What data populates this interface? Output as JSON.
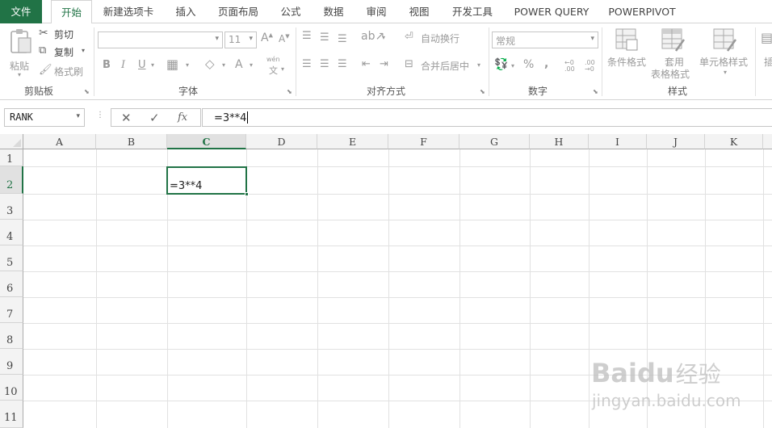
{
  "tabs": [
    {
      "label": "文件"
    },
    {
      "label": "开始"
    },
    {
      "label": "新建选项卡"
    },
    {
      "label": "插入"
    },
    {
      "label": "页面布局"
    },
    {
      "label": "公式"
    },
    {
      "label": "数据"
    },
    {
      "label": "审阅"
    },
    {
      "label": "视图"
    },
    {
      "label": "开发工具"
    },
    {
      "label": "POWER QUERY"
    },
    {
      "label": "POWERPIVOT"
    }
  ],
  "ribbon": {
    "clipboard": {
      "paste": "粘贴",
      "cut": "剪切",
      "copy": "复制",
      "format_painter": "格式刷",
      "group": "剪贴板"
    },
    "font": {
      "size": "11",
      "bold": "B",
      "italic": "I",
      "underline": "U",
      "wen": "wén",
      "wen_char": "文",
      "font_color": "A",
      "group": "字体"
    },
    "alignment": {
      "wrap": "自动换行",
      "merge": "合并后居中",
      "group": "对齐方式"
    },
    "number": {
      "format": "常规",
      "percent": "%",
      "comma": ",",
      "group": "数字"
    },
    "styles": {
      "conditional": "条件格式",
      "table_1": "套用",
      "table_2": "表格格式",
      "cell_styles": "单元格样式",
      "group": "样式",
      "insert_cut": "插"
    }
  },
  "formula_bar": {
    "name_box": "RANK",
    "fx": "fx",
    "formula": "=3**4"
  },
  "sheet": {
    "columns": [
      "A",
      "B",
      "C",
      "D",
      "E",
      "F",
      "G",
      "H",
      "I",
      "J",
      "K"
    ],
    "rows": [
      "1",
      "2",
      "3",
      "4",
      "5",
      "6",
      "7",
      "8",
      "9",
      "10",
      "11"
    ],
    "active_column": "C",
    "active_row": "2",
    "cell_c2": "=3**4"
  },
  "watermark": {
    "brand": "Baidu",
    "jingyan": "经验",
    "url": "jingyan.baidu.com"
  },
  "colors": {
    "accent": "#217346",
    "file_tab": "#217346"
  }
}
